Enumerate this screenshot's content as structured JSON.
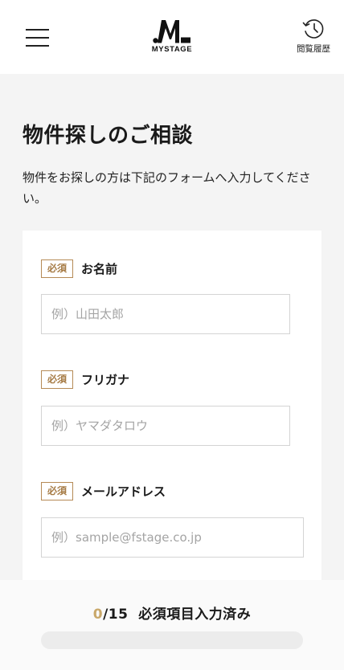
{
  "header": {
    "logo_text": "MYSTAGE",
    "history_label": "閲覧履歴"
  },
  "page": {
    "title": "物件探しのご相談",
    "description": "物件をお探しの方は下記のフォームへ入力してください。"
  },
  "form": {
    "required_label": "必須",
    "fields": [
      {
        "label": "お名前",
        "placeholder": "例）山田太郎"
      },
      {
        "label": "フリガナ",
        "placeholder": "例）ヤマダタロウ"
      },
      {
        "label": "メールアドレス",
        "placeholder": "例）sample@fstage.co.jp"
      }
    ]
  },
  "progress": {
    "completed": "0",
    "total": "/15",
    "label": "必須項目入力済み",
    "fraction": 0
  },
  "colors": {
    "accent": "#c9a86a",
    "required_badge": "#a67b45"
  },
  "icons": {
    "menu": "hamburger-menu-icon",
    "history": "history-clock-icon"
  }
}
